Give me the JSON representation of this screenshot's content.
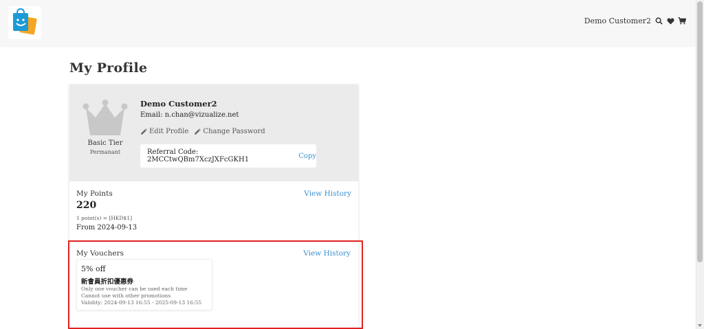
{
  "header": {
    "user_name": "Demo Customer2",
    "icons": [
      "search-icon",
      "heart-icon",
      "cart-icon"
    ]
  },
  "page": {
    "title": "My Profile"
  },
  "profile": {
    "tier": "Basic Tier",
    "tier_status": "Permanant",
    "name": "Demo Customer2",
    "email_label": "Email:",
    "email": "n.chan@vizualize.net",
    "edit_profile": "Edit Profile",
    "change_password": "Change Password",
    "referral_label": "Referral Code:",
    "referral_code": "2MCCtwQBm7XczJXFcGKH1",
    "copy_label": "Copy"
  },
  "points": {
    "label": "My Points",
    "view_history": "View History",
    "value": "220",
    "rate": "1 point(s) = [HKD$1]",
    "from": "From 2024-09-13"
  },
  "vouchers": {
    "label": "My Vouchers",
    "view_history": "View History",
    "items": [
      {
        "title": "5% off",
        "name": "新會員折扣優惠券",
        "line1": "Only one voucher can be used each time",
        "line2": "Cannot use with other promotions",
        "validity": "Validity: 2024-09-13 16:55 - 2025-09-13 16:55"
      }
    ]
  },
  "colors": {
    "accent_link": "#3a8fd0",
    "highlight_border": "#e02020",
    "logo_blue": "#1e9ad6",
    "logo_orange": "#f5a623"
  }
}
